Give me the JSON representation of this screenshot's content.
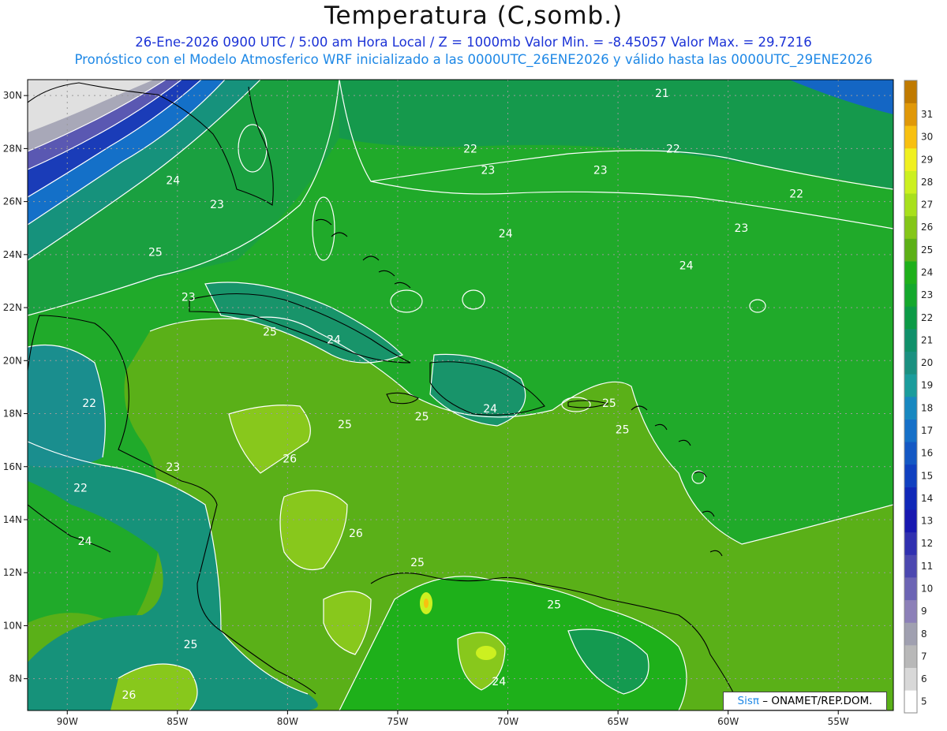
{
  "title": "Temperatura (C,somb.)",
  "subtitle1": "26-Ene-2026  0900 UTC / 5:00 am Hora Local / Z = 1000mb   Valor Min. = -8.45057  Valor Max. = 29.7216",
  "subtitle2": "Pronóstico con el Modelo Atmosferico WRF inicializado a las 0000UTC_26ENE2026 y válido hasta las  0000UTC_29ENE2026",
  "logo": {
    "brand": "Sisπ",
    "text": " – ONAMET/REP.DOM."
  },
  "axes": {
    "lon_labels": [
      "90W",
      "85W",
      "80W",
      "75W",
      "70W",
      "65W",
      "60W",
      "55W"
    ],
    "lon_values": [
      -90,
      -85,
      -80,
      -75,
      -70,
      -65,
      -60,
      -55
    ],
    "lat_labels": [
      "30N",
      "28N",
      "26N",
      "24N",
      "22N",
      "20N",
      "18N",
      "16N",
      "14N",
      "12N",
      "10N",
      "8N"
    ],
    "lat_values": [
      30,
      28,
      26,
      24,
      22,
      20,
      18,
      16,
      14,
      12,
      10,
      8
    ],
    "lon_range": [
      -91.8,
      -52.5
    ],
    "lat_range": [
      6.8,
      30.6
    ]
  },
  "colorbar": {
    "values": [
      5,
      6,
      7,
      8,
      9,
      10,
      11,
      12,
      13,
      14,
      15,
      16,
      17,
      18,
      19,
      20,
      21,
      22,
      23,
      24,
      25,
      26,
      27,
      28,
      29,
      30,
      31
    ],
    "colors": [
      "#ffffff",
      "#d8d8d8",
      "#b8b8b8",
      "#a0a0b0",
      "#8c80b8",
      "#6c64b4",
      "#4c48b0",
      "#3030b0",
      "#1818b0",
      "#1028b8",
      "#1040c0",
      "#1458c4",
      "#1670c8",
      "#1888c0",
      "#1a9c9c",
      "#1a9080",
      "#10906a",
      "#0c9a46",
      "#14a82c",
      "#1eb01a",
      "#5cb016",
      "#84c618",
      "#a8e01c",
      "#ccf020",
      "#f0f020",
      "#f8c010",
      "#e09808",
      "#c07a00"
    ]
  },
  "contour_labels": [
    {
      "text": "21",
      "lon": -63.0,
      "lat": 30.1
    },
    {
      "text": "22",
      "lon": -71.7,
      "lat": 28.0
    },
    {
      "text": "22",
      "lon": -62.5,
      "lat": 28.0
    },
    {
      "text": "22",
      "lon": -56.9,
      "lat": 26.3
    },
    {
      "text": "23",
      "lon": -70.9,
      "lat": 27.2
    },
    {
      "text": "23",
      "lon": -65.8,
      "lat": 27.2
    },
    {
      "text": "23",
      "lon": -59.4,
      "lat": 25.0
    },
    {
      "text": "24",
      "lon": -85.2,
      "lat": 26.8
    },
    {
      "text": "23",
      "lon": -83.2,
      "lat": 25.9
    },
    {
      "text": "24",
      "lon": -70.1,
      "lat": 24.8
    },
    {
      "text": "24",
      "lon": -61.9,
      "lat": 23.6
    },
    {
      "text": "25",
      "lon": -86.0,
      "lat": 24.1
    },
    {
      "text": "23",
      "lon": -84.5,
      "lat": 22.4
    },
    {
      "text": "25",
      "lon": -80.8,
      "lat": 21.1
    },
    {
      "text": "24",
      "lon": -77.9,
      "lat": 20.8
    },
    {
      "text": "22",
      "lon": -89.0,
      "lat": 18.4
    },
    {
      "text": "25",
      "lon": -73.9,
      "lat": 17.9
    },
    {
      "text": "24",
      "lon": -70.8,
      "lat": 18.2
    },
    {
      "text": "25",
      "lon": -65.4,
      "lat": 18.4
    },
    {
      "text": "25",
      "lon": -77.4,
      "lat": 17.6
    },
    {
      "text": "25",
      "lon": -64.8,
      "lat": 17.4
    },
    {
      "text": "26",
      "lon": -79.9,
      "lat": 16.3
    },
    {
      "text": "23",
      "lon": -85.2,
      "lat": 16.0
    },
    {
      "text": "22",
      "lon": -89.4,
      "lat": 15.2
    },
    {
      "text": "24",
      "lon": -89.2,
      "lat": 13.2
    },
    {
      "text": "26",
      "lon": -76.9,
      "lat": 13.5
    },
    {
      "text": "25",
      "lon": -74.1,
      "lat": 12.4
    },
    {
      "text": "25",
      "lon": -67.9,
      "lat": 10.8
    },
    {
      "text": "25",
      "lon": -84.4,
      "lat": 9.3
    },
    {
      "text": "24",
      "lon": -70.4,
      "lat": 7.9
    },
    {
      "text": "26",
      "lon": -87.2,
      "lat": 7.4
    }
  ]
}
